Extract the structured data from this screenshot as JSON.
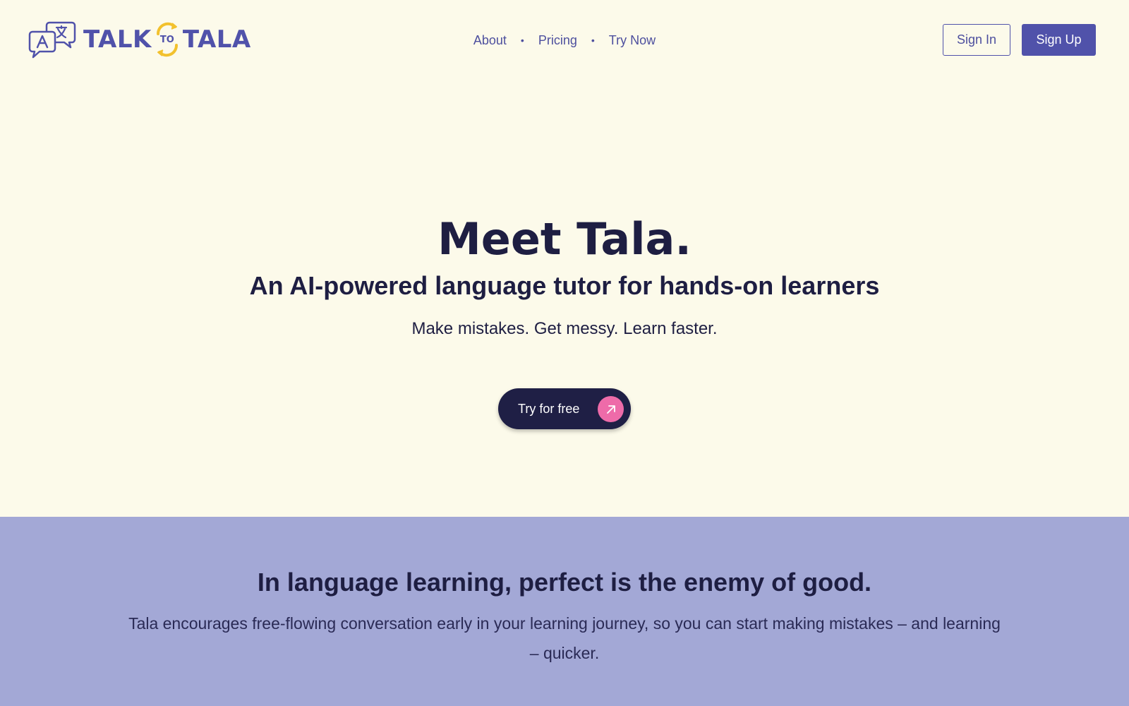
{
  "brand": {
    "word_left": "TALK",
    "word_mid": "TO",
    "word_right": "TALA",
    "primary_color": "#5052aa",
    "accent_color": "#f2c12e",
    "icon": "chat-translate-icon"
  },
  "nav": {
    "items": [
      {
        "label": "About"
      },
      {
        "label": "Pricing"
      },
      {
        "label": "Try Now"
      }
    ]
  },
  "auth": {
    "sign_in_label": "Sign In",
    "sign_up_label": "Sign Up"
  },
  "hero": {
    "title": "Meet Tala.",
    "subtitle": "An AI-powered language tutor for hands-on learners",
    "tagline": "Make mistakes. Get messy. Learn faster.",
    "cta_label": "Try for free",
    "cta_icon": "arrow-up-right-icon",
    "cta_icon_color": "#ee6ba9"
  },
  "band": {
    "background_color": "#a3a8d6",
    "title": "In language learning, perfect is the enemy of good.",
    "text": "Tala encourages free-flowing conversation early in your learning journey, so you can start making mistakes – and learning – quicker."
  }
}
